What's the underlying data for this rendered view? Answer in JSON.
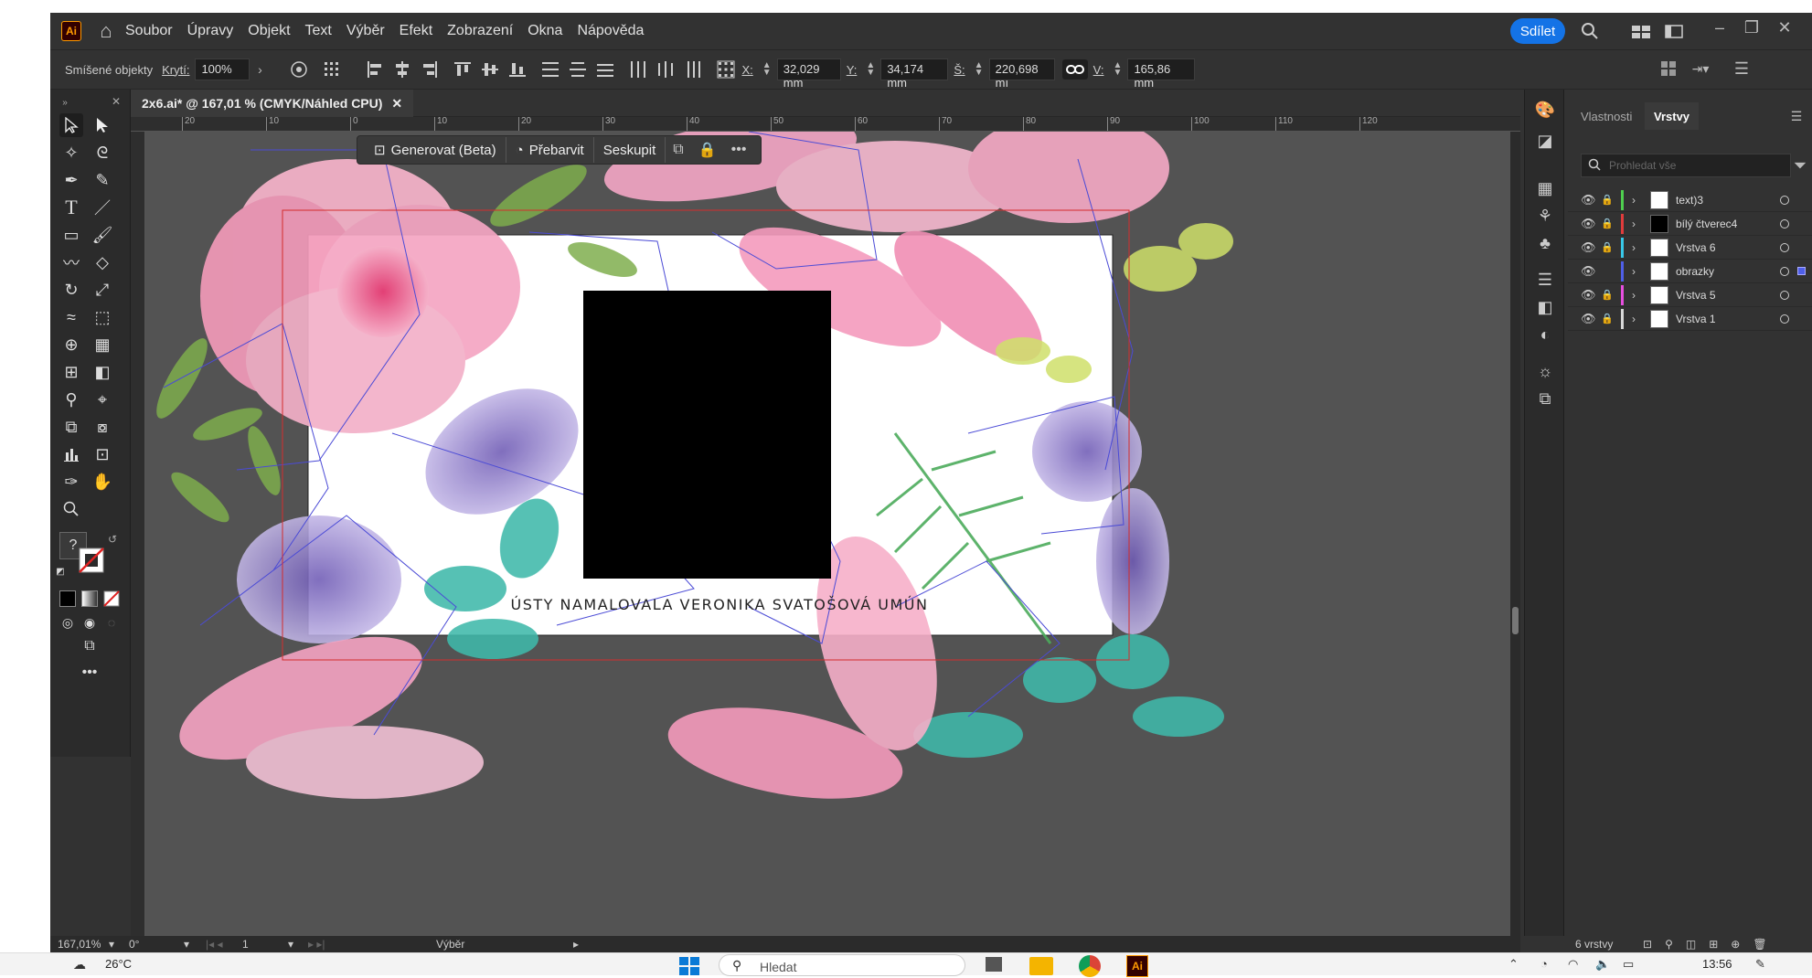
{
  "menu": {
    "items": [
      "Soubor",
      "Úpravy",
      "Objekt",
      "Text",
      "Výběr",
      "Efekt",
      "Zobrazení",
      "Okna",
      "Nápověda"
    ],
    "share_label": "Sdílet"
  },
  "control": {
    "mixed_objects_label": "Smíšené objekty",
    "opacity_label": "Krytí:",
    "opacity_value": "100%",
    "x_label": "X:",
    "x_value": "32,029 mm",
    "y_label": "Y:",
    "y_value": "34,174 mm",
    "w_label": "Š:",
    "w_value": "220,698 mı",
    "h_label": "V:",
    "h_value": "165,86 mm"
  },
  "document": {
    "tab_title": "2x6.ai* @ 167,01 % (CMYK/Náhled CPU)",
    "ruler_ticks": [
      "20",
      "10",
      "0",
      "10",
      "20",
      "30",
      "40",
      "50",
      "60",
      "70",
      "80",
      "90",
      "100",
      "110",
      "120"
    ],
    "artboard_text": "ÚSTY NAMALOVALA VERONIKA SVATOŠOVÁ UMÚN"
  },
  "context_bar": {
    "generate_label": "Generovat (Beta)",
    "recolor_label": "Přebarvit",
    "group_label": "Seskupit"
  },
  "status": {
    "zoom": "167,01%",
    "angle": "0°",
    "artboard_num": "1",
    "tool_name": "Výběr"
  },
  "layers_panel": {
    "tab_properties": "Vlastnosti",
    "tab_layers": "Vrstvy",
    "search_placeholder": "Prohledat vše",
    "layers": [
      {
        "name": "text)3",
        "color": "#4fcf4f",
        "thumb": "#ffffff",
        "locked": true
      },
      {
        "name": "bílý čtverec4",
        "color": "#e03c3c",
        "thumb": "#000000",
        "locked": true
      },
      {
        "name": "Vrstva 6",
        "color": "#38c8e8",
        "thumb": "#ffffff",
        "locked": true
      },
      {
        "name": "obrazky",
        "color": "#4f5fe8",
        "thumb": "#ffffff",
        "locked": false
      },
      {
        "name": "Vrstva 5",
        "color": "#e84fe0",
        "thumb": "#ffffff",
        "locked": true
      },
      {
        "name": "Vrstva 1",
        "color": "#d8d8d8",
        "thumb": "#ffffff",
        "locked": true
      }
    ],
    "footer_count": "6 vrstvy"
  },
  "taskbar": {
    "weather": "26°C",
    "search_label": "Hledat",
    "time": "13:56"
  }
}
